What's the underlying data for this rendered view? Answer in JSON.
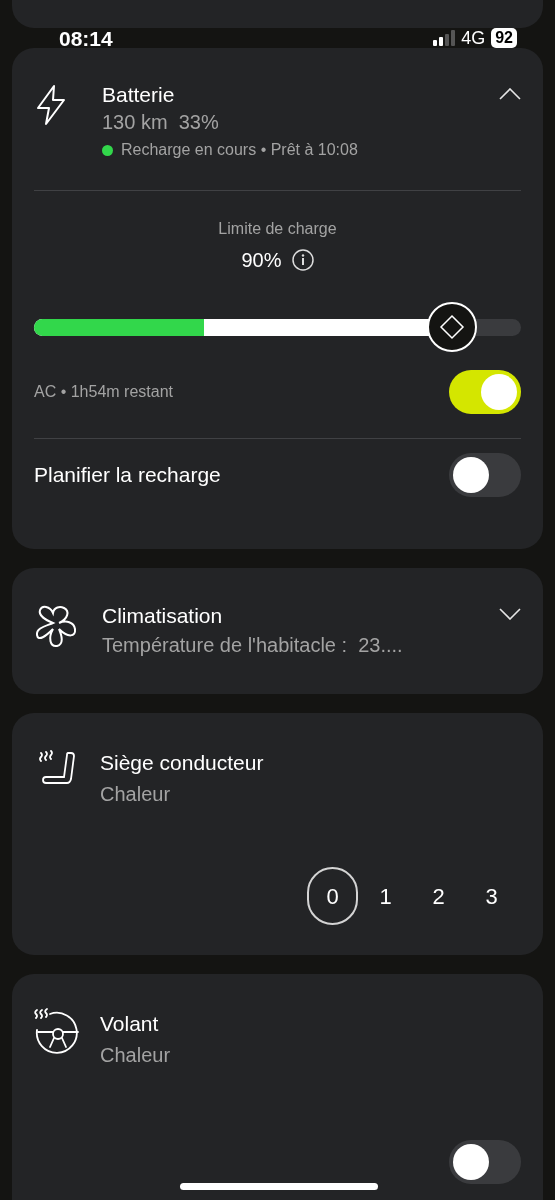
{
  "status_bar": {
    "time": "08:14",
    "network": "4G",
    "battery": "92"
  },
  "battery_card": {
    "title": "Batterie",
    "range": "130 km  33%",
    "expanded": true,
    "status": "Recharge en cours • Prêt à 10:08",
    "charging": true,
    "limit_label": "Limite de charge",
    "limit_value": "90%",
    "slider": {
      "segments": [
        {
          "kind": "charged",
          "level": 0.35
        },
        {
          "kind": "limit",
          "level": 0.858
        }
      ]
    },
    "charging_info": "AC • 1h54m restant",
    "charging_on": true,
    "schedule_label": "Planifier la recharge",
    "schedule_on": false
  },
  "climate_card": {
    "title": "Climatisation",
    "subtitle": "Température de l'habitacle :  23....",
    "expanded": false
  },
  "seat_card": {
    "title": "Siège conducteur",
    "subtitle": "Chaleur",
    "levels": [
      {
        "label": "0",
        "selected": true
      },
      {
        "label": "1",
        "selected": false
      },
      {
        "label": "2",
        "selected": false
      },
      {
        "label": "3",
        "selected": false
      }
    ]
  },
  "wheel_card": {
    "title": "Volant",
    "subtitle": "Chaleur",
    "on": false
  }
}
